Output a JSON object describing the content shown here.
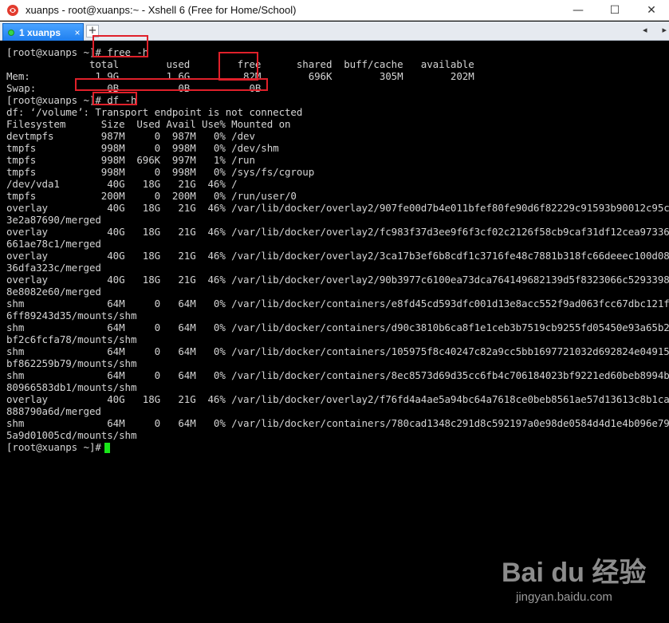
{
  "window": {
    "title": "xuanps - root@xuanps:~ - Xshell 6 (Free for Home/School)",
    "minimize_glyph": "—",
    "maximize_glyph": "☐",
    "close_glyph": "✕",
    "app_icon": "xshell-logo-icon"
  },
  "tabs": {
    "active_label": "1 xuanps",
    "close_glyph": "×",
    "add_glyph": "+",
    "nav_left": "◂",
    "nav_right": "▸"
  },
  "terminal": {
    "lines": [
      "[root@xuanps ~]# free -h",
      "              total        used        free      shared  buff/cache   available",
      "Mem:           1.9G        1.6G         82M        696K        305M        202M",
      "Swap:            0B          0B          0B",
      "[root@xuanps ~]# df -h",
      "df: ‘/volume’: Transport endpoint is not connected",
      "Filesystem      Size  Used Avail Use% Mounted on",
      "devtmpfs        987M     0  987M   0% /dev",
      "tmpfs           998M     0  998M   0% /dev/shm",
      "tmpfs           998M  696K  997M   1% /run",
      "tmpfs           998M     0  998M   0% /sys/fs/cgroup",
      "/dev/vda1        40G   18G   21G  46% /",
      "tmpfs           200M     0  200M   0% /run/user/0",
      "overlay          40G   18G   21G  46% /var/lib/docker/overlay2/907fe00d7b4e011bfef80fe90d6f82229c91593b90012c95c0c5ea7",
      "3e2a87690/merged",
      "overlay          40G   18G   21G  46% /var/lib/docker/overlay2/fc983f37d3ee9f6f3cf02c2126f58cb9caf31df12cea9733653f1ae",
      "661ae78c1/merged",
      "overlay          40G   18G   21G  46% /var/lib/docker/overlay2/3ca17b3ef6b8cdf1c3716fe48c7881b318fc66deeec100d087fd9d4",
      "36dfa323c/merged",
      "overlay          40G   18G   21G  46% /var/lib/docker/overlay2/90b3977c6100ea73dca764149682139d5f8323066c5293398647433",
      "8e8082e60/merged",
      "shm              64M     0   64M   0% /var/lib/docker/containers/e8fd45cd593dfc001d13e8acc552f9ad063fcc67dbc121f136384",
      "6ff89243d35/mounts/shm",
      "shm              64M     0   64M   0% /var/lib/docker/containers/d90c3810b6ca8f1e1ceb3b7519cb9255fd05450e93a65b2fa3762",
      "bf2c6fcfa78/mounts/shm",
      "shm              64M     0   64M   0% /var/lib/docker/containers/105975f8c40247c82a9cc5bb1697721032d692824e049154e733f",
      "bf862259b79/mounts/shm",
      "shm              64M     0   64M   0% /var/lib/docker/containers/8ec8573d69d35cc6fb4c706184023bf9221ed60beb8994bb1441b",
      "80966583db1/mounts/shm",
      "overlay          40G   18G   21G  46% /var/lib/docker/overlay2/f76fd4a4ae5a94bc64a7618ce0beb8561ae57d13613c8b1cab196d8",
      "888790a6d/merged",
      "shm              64M     0   64M   0% /var/lib/docker/containers/780cad1348c291d8c592197a0e98de0584d4d1e4b096e7944d288",
      "5a9d01005cd/mounts/shm"
    ],
    "prompt": "[root@xuanps ~]#"
  },
  "watermark": {
    "logo": "Bai du 经验",
    "url": "jingyan.baidu.com"
  },
  "colors": {
    "terminal_bg": "#000000",
    "terminal_fg": "#d4d4d4",
    "cursor": "#19e619",
    "highlight_box": "#e0202a",
    "tab_active": "#1e7ff0"
  }
}
